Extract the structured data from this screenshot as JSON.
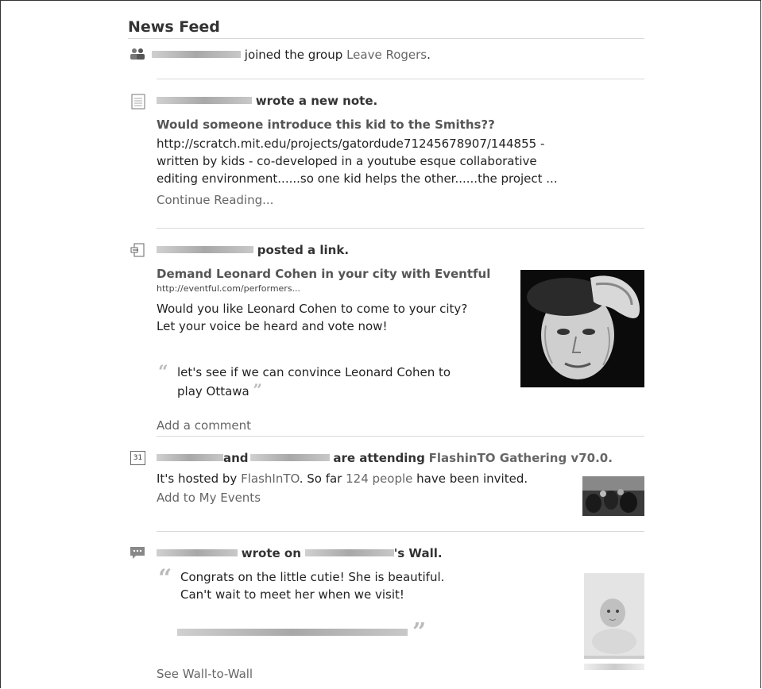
{
  "feed_title": "News Feed",
  "item1": {
    "text": "joined the group",
    "group": "Leave Rogers",
    "end": "."
  },
  "item2": {
    "action": "wrote a new note.",
    "note_title": "Would someone introduce this kid to the Smiths??",
    "body_lines": [
      "http://scratch.mit.edu/projects/gatordude71245678907/144855 -",
      "written by kids - co-developed in a youtube esque collaborative",
      "editing environment......so one kid helps the other......the project ..."
    ],
    "continue": "Continue Reading..."
  },
  "item3": {
    "action": "posted a link.",
    "link_title": "Demand Leonard Cohen in your city with Eventful",
    "link_url": "http://eventful.com/performers...",
    "desc_lines": [
      "Would you like Leonard Cohen to come to your city?",
      "Let your voice be heard and vote now!"
    ],
    "quote_lines": [
      "let's see if we can convince Leonard Cohen to",
      "play Ottawa"
    ],
    "add_comment": "Add a comment"
  },
  "item4": {
    "and": "and",
    "attending": "are attending",
    "event": "FlashinTO Gathering v70.0.",
    "hosted_pre": "It's hosted by",
    "host": "FlashInTO",
    "so_far": ". So far",
    "people": "124 people",
    "invited": "have been invited.",
    "add_events": "Add to My Events",
    "calendar_day": "31"
  },
  "item5": {
    "wrote_on": "wrote on",
    "wall": "'s Wall.",
    "quote_lines": [
      "Congrats on the little cutie! She is beautiful.",
      "Can't wait to meet her when we visit!"
    ],
    "see_wall": "See Wall-to-Wall"
  },
  "quote_open": "“",
  "quote_close": "”"
}
